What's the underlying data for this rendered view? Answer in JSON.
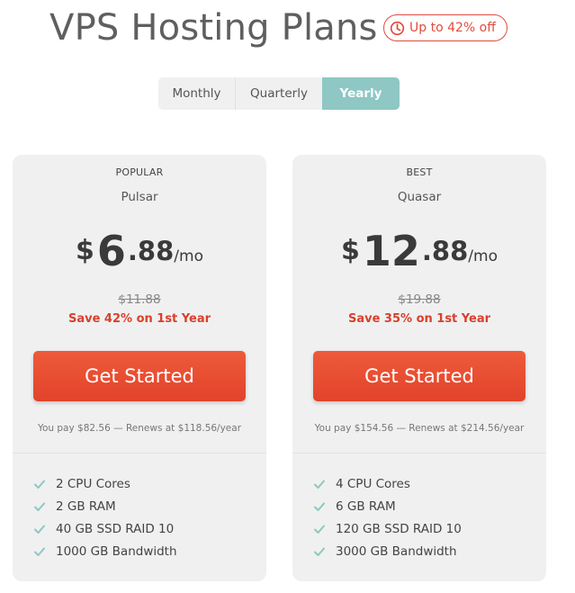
{
  "header": {
    "title": "VPS Hosting Plans",
    "badge": {
      "icon": "clock-icon",
      "label": "Up to 42% off",
      "color": "#e04c3c"
    }
  },
  "billing_toggle": {
    "options": [
      "Monthly",
      "Quarterly",
      "Yearly"
    ],
    "selected": "Yearly",
    "selected_color": "#8ec7c3"
  },
  "plans": [
    {
      "tag": "POPULAR",
      "name": "Pulsar",
      "price": {
        "currency": "$",
        "dollars": "6",
        "cents": ".88",
        "period": "/mo"
      },
      "old_price": "$11.88",
      "save_text": "Save 42% on 1st Year",
      "cta_label": "Get Started",
      "renew_text": "You pay $82.56 — Renews at $118.56/year",
      "features": [
        "2 CPU Cores",
        "2 GB RAM",
        "40 GB SSD RAID 10",
        "1000 GB Bandwidth"
      ]
    },
    {
      "tag": "BEST",
      "name": "Quasar",
      "price": {
        "currency": "$",
        "dollars": "12",
        "cents": ".88",
        "period": "/mo"
      },
      "old_price": "$19.88",
      "save_text": "Save 35% on 1st Year",
      "cta_label": "Get Started",
      "renew_text": "You pay $154.56 — Renews at $214.56/year",
      "features": [
        "4 CPU Cores",
        "6 GB RAM",
        "120 GB SSD RAID 10",
        "3000 GB Bandwidth"
      ]
    }
  ],
  "colors": {
    "accent_red": "#e2432b",
    "check_teal": "#8ec7c3",
    "card_bg": "#f0f0f0"
  }
}
